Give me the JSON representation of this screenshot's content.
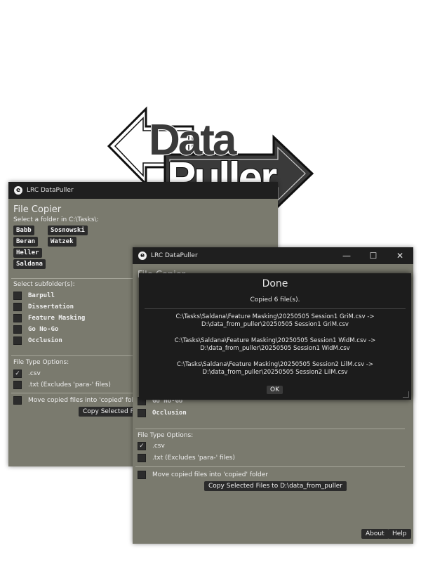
{
  "logo": {
    "line1": "Data",
    "line2": "Puller"
  },
  "back_window": {
    "title": "LRC DataPuller",
    "section_title": "File Copier",
    "folder_prompt": "Select a folder in C:\\Tasks\\:",
    "folders": [
      "Babb",
      "Sosnowski",
      "Beran",
      "Watzek",
      "Heller",
      "Saldana"
    ],
    "subfolder_prompt": "Select subfolder(s):",
    "subfolders": [
      "Barpull",
      "Dissertation",
      "Feature Masking",
      "Go No-Go",
      "Occlusion"
    ],
    "file_type_label": "File Type Options:",
    "csv_label": ".csv",
    "txt_label": ".txt (Excludes 'para-' files)",
    "move_label": "Move copied files into 'copied' folder",
    "copy_button": "Copy Selected File"
  },
  "front_window": {
    "title": "LRC DataPuller",
    "section_title": "File Copier",
    "subfolders_visible": [
      "Go No-Go",
      "Occlusion"
    ],
    "file_type_label": "File Type Options:",
    "csv_label": ".csv",
    "txt_label": ".txt (Excludes 'para-' files)",
    "move_label": "Move copied files into 'copied' folder",
    "copy_button": "Copy Selected Files to D:\\data_from_puller",
    "about_button": "About",
    "help_button": "Help",
    "controls": {
      "minimize": "—",
      "maximize": "☐",
      "close": "✕"
    }
  },
  "dialog": {
    "title": "Done",
    "status": "Copied 6 file(s).",
    "entries": [
      {
        "src": "C:\\Tasks\\Saldana\\Feature Masking\\20250505 Session1 GriM.csv ->",
        "dst": "D:\\data_from_puller\\20250505 Session1 GriM.csv"
      },
      {
        "src": "C:\\Tasks\\Saldana\\Feature Masking\\20250505 Session1 WidM.csv ->",
        "dst": "D:\\data_from_puller\\20250505 Session1 WidM.csv"
      },
      {
        "src": "C:\\Tasks\\Saldana\\Feature Masking\\20250505 Session2 LilM.csv ->",
        "dst": "D:\\data_from_puller\\20250505 Session2 LilM.csv"
      }
    ],
    "ok_button": "OK"
  }
}
